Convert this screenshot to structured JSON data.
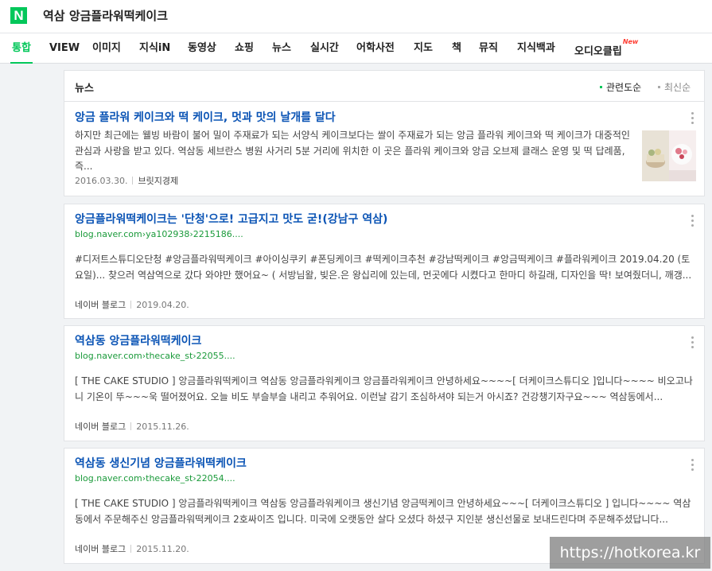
{
  "header": {
    "logo": "N",
    "query": "역삼 앙금플라워떡케이크"
  },
  "tabs": [
    "통합",
    "VIEW",
    "이미지",
    "지식iN",
    "동영상",
    "쇼핑",
    "뉴스",
    "실시간",
    "어학사전",
    "지도",
    "책",
    "뮤직",
    "지식백과",
    "오디오클립"
  ],
  "tab_badge": "New",
  "colors": {
    "brand": "#03c75a",
    "link": "#0b54b5",
    "url": "#1a9a3a"
  },
  "section": {
    "title": "뉴스",
    "sort_relevance": "관련도순",
    "sort_latest": "최신순"
  },
  "results": [
    {
      "title": "앙금 플라워 케이크와 떡 케이크, 멋과 맛의 날개를 달다",
      "desc": "하지만 최근에는 웰빙 바람이 불어 밀이 주재료가 되는 서양식 케이크보다는 쌀이 주재료가 되는 앙금 플라워 케이크와 떡 케이크가 대중적인 관심과 사랑을 받고 있다. 역삼동 세브란스 병원 사거리 5분 거리에 위치한 이 곳은 플라워 케이크와 앙금 오브제 클래스 운영 및 떡 답례품, 즉...",
      "date": "2016.03.30.",
      "source": "브릿지경제"
    },
    {
      "title": "앙금플라워떡케이크는 '단청'으로! 고급지고 맛도 굳!(강남구 역삼)",
      "url": "blog.naver.com›ya102938›2215186....",
      "desc": "#디저트스튜디오단청 #앙금플라워떡케이크 #아이싱쿠키 #폰딩케이크 #떡케이크추천 #강남떡케이크 #앙금떡케이크 #플라워케이크 2019.04.20 (토요일)... 찾으러 역삼역으로 갔다 와야만 했어요~ ( 서방님왈, 빚은.은 왕십리에 있는데, 먼곳에다 시켰다고 한마디 하길래, 디자인을 딱! 보여줬더니, 깨갱...",
      "source": "네이버 블로그",
      "date": "2019.04.20."
    },
    {
      "title": "역삼동 앙금플라워떡케이크",
      "url": "blog.naver.com›thecake_st›22055....",
      "desc": "[ THE CAKE STUDIO ] 앙금플라워떡케이크 역삼동 앙금플라워케이크 앙금플라워케이크 안녕하세요~~~~[ 더케이크스튜디오 ]입니다~~~~ 비오고나니 기온이 뚜~~~욱 떨어졌어요. 오늘 비도 부슬부슬 내리고 추워어요. 이런날 감기 조심하셔야 되는거 아시죠? 건강챙기자구요~~~ 역삼동에서...",
      "source": "네이버 블로그",
      "date": "2015.11.26."
    },
    {
      "title": "역삼동 생신기념 앙금플라워떡케이크",
      "url": "blog.naver.com›thecake_st›22054....",
      "desc": "[ THE CAKE STUDIO ] 앙금플라워떡케이크 역삼동 앙금플라워케이크 생신기념 앙금떡케이크 안녕하세요~~~[ 더케이크스튜디오 ] 입니다~~~~ 역삼동에서 주문해주신 앙금플라워떡케이크 2호싸이즈 입니다. 미국에 오랫동안 살다 오셨다 하셨구 지인분 생신선물로 보내드린다며 주문해주셨답니다...",
      "source": "네이버 블로그",
      "date": "2015.11.20."
    }
  ],
  "watermark": "https://hotkorea.kr"
}
